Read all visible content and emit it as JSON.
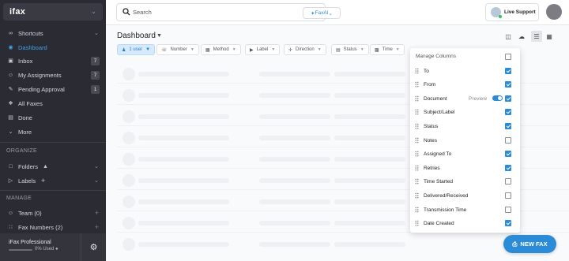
{
  "app": {
    "logo": "ifax"
  },
  "sidebar": {
    "items": [
      {
        "label": "Shortcuts",
        "icon": "link-icon",
        "trailing": "chevron"
      },
      {
        "label": "Dashboard",
        "icon": "dashboard-icon",
        "active": true
      },
      {
        "label": "Inbox",
        "icon": "inbox-icon",
        "badge": "7"
      },
      {
        "label": "My Assignments",
        "icon": "user-circle-icon",
        "badge": "7"
      },
      {
        "label": "Pending Approval",
        "icon": "approval-icon",
        "badge": "1"
      },
      {
        "label": "All Faxes",
        "icon": "faxes-icon"
      },
      {
        "label": "Done",
        "icon": "done-icon"
      },
      {
        "label": "More",
        "icon": "chevron-down-icon"
      }
    ],
    "organize": {
      "heading": "ORGANIZE",
      "items": [
        {
          "label": "Folders",
          "icon": "folder-icon"
        },
        {
          "label": "Labels",
          "icon": "label-icon"
        }
      ]
    },
    "manage": {
      "heading": "MANAGE",
      "items": [
        {
          "label": "Team (0)",
          "icon": "team-icon"
        },
        {
          "label": "Fax Numbers (2)",
          "icon": "grid-icon"
        }
      ]
    },
    "plan": {
      "name": "iFax Professional",
      "used": "0% Used"
    }
  },
  "topbar": {
    "search_placeholder": "Search",
    "faxai_label": "FaxAI",
    "support_label": "Live Support"
  },
  "main": {
    "title": "Dashboard",
    "filters": [
      {
        "label": "1 user",
        "selected": true
      },
      {
        "label": "Number"
      },
      {
        "label": "Method"
      },
      {
        "label": "Label"
      },
      {
        "label": "Direction"
      },
      {
        "label": "Status"
      },
      {
        "label": "Time"
      }
    ]
  },
  "manage_columns": {
    "heading": "Manage Columns",
    "header_checked": false,
    "columns": [
      {
        "label": "To",
        "checked": true
      },
      {
        "label": "From",
        "checked": true
      },
      {
        "label": "Document",
        "checked": true,
        "preview_label": "Preview",
        "preview_on": true
      },
      {
        "label": "Subject/Label",
        "checked": true
      },
      {
        "label": "Status",
        "checked": true
      },
      {
        "label": "Notes",
        "checked": false
      },
      {
        "label": "Assigned To",
        "checked": true
      },
      {
        "label": "Retries",
        "checked": true
      },
      {
        "label": "Time Started",
        "checked": false
      },
      {
        "label": "Delivered/Received",
        "checked": false
      },
      {
        "label": "Transmission Time",
        "checked": false
      },
      {
        "label": "Date Created",
        "checked": true
      }
    ]
  },
  "new_fax_label": "NEW FAX",
  "colors": {
    "accent": "#2b8bd6",
    "sidebar_bg": "#2b2b33",
    "active_nav": "#3fa3e6"
  }
}
